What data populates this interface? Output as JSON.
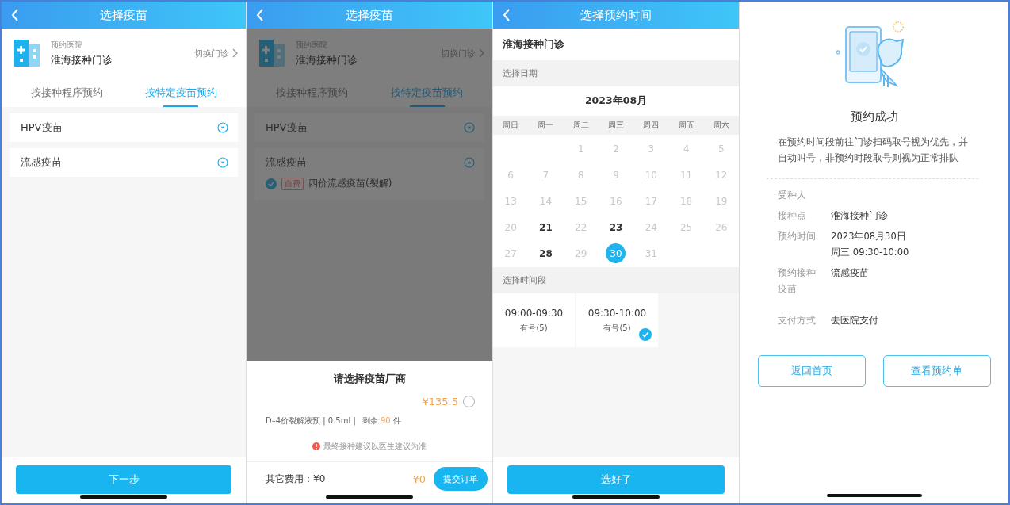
{
  "screen_1": {
    "title": "选择疫苗",
    "hospital": {
      "label": "预约医院",
      "name": "淮海接种门诊",
      "switch": "切换门诊"
    },
    "tabs": [
      {
        "label": "按接种程序预约",
        "selected": false
      },
      {
        "label": "按特定疫苗预约",
        "selected": true
      }
    ],
    "groups": [
      {
        "name": "HPV疫苗",
        "expanded": false
      },
      {
        "name": "流感疫苗",
        "expanded": false
      }
    ],
    "next_button": "下一步"
  },
  "screen_2": {
    "title": "选择疫苗",
    "hospital": {
      "label": "预约医院",
      "name": "淮海接种门诊",
      "switch": "切换门诊"
    },
    "tabs": [
      {
        "label": "按接种程序预约",
        "selected": false
      },
      {
        "label": "按特定疫苗预约",
        "selected": true
      }
    ],
    "groups": [
      {
        "name": "HPV疫苗",
        "expanded": false
      },
      {
        "name": "流感疫苗",
        "expanded": true,
        "items": [
          {
            "tag": "自费",
            "name": "四价流感疫苗(裂解)",
            "checked": true
          }
        ]
      }
    ],
    "sheet": {
      "title": "请选择疫苗厂商",
      "options": [
        {
          "price": "¥135.5",
          "selected": false,
          "spec": "D–4价裂解液预 | 0.5ml |",
          "stock_label": "剩余",
          "stock": "90",
          "unit": "件"
        }
      ],
      "note": "最终接种建议以医生建议为准",
      "other_fees": "其它费用：¥0",
      "total": "¥0",
      "submit": "提交订单"
    }
  },
  "screen_3": {
    "title": "选择预约时间",
    "clinic": "淮海接种门诊",
    "date_label": "选择日期",
    "month": "2023年08月",
    "weekdays": [
      "周日",
      "周一",
      "周二",
      "周三",
      "周四",
      "周五",
      "周六"
    ],
    "days": [
      {
        "day": "1",
        "available": false,
        "selected": false
      },
      {
        "day": "2",
        "available": false,
        "selected": false
      },
      {
        "day": "3",
        "available": false,
        "selected": false
      },
      {
        "day": "4",
        "available": false,
        "selected": false
      },
      {
        "day": "5",
        "available": false,
        "selected": false
      },
      {
        "day": "6",
        "available": false,
        "selected": false
      },
      {
        "day": "7",
        "available": false,
        "selected": false
      },
      {
        "day": "8",
        "available": false,
        "selected": false
      },
      {
        "day": "9",
        "available": false,
        "selected": false
      },
      {
        "day": "10",
        "available": false,
        "selected": false
      },
      {
        "day": "11",
        "available": false,
        "selected": false
      },
      {
        "day": "12",
        "available": false,
        "selected": false
      },
      {
        "day": "13",
        "available": false,
        "selected": false
      },
      {
        "day": "14",
        "available": false,
        "selected": false
      },
      {
        "day": "15",
        "available": false,
        "selected": false
      },
      {
        "day": "16",
        "available": false,
        "selected": false
      },
      {
        "day": "17",
        "available": false,
        "selected": false
      },
      {
        "day": "18",
        "available": false,
        "selected": false
      },
      {
        "day": "19",
        "available": false,
        "selected": false
      },
      {
        "day": "20",
        "available": false,
        "selected": false
      },
      {
        "day": "21",
        "available": true,
        "selected": false
      },
      {
        "day": "22",
        "available": false,
        "selected": false
      },
      {
        "day": "23",
        "available": true,
        "selected": false
      },
      {
        "day": "24",
        "available": false,
        "selected": false
      },
      {
        "day": "25",
        "available": false,
        "selected": false
      },
      {
        "day": "26",
        "available": false,
        "selected": false
      },
      {
        "day": "27",
        "available": false,
        "selected": false
      },
      {
        "day": "28",
        "available": true,
        "selected": false
      },
      {
        "day": "29",
        "available": false,
        "selected": false
      },
      {
        "day": "30",
        "available": true,
        "selected": true
      },
      {
        "day": "31",
        "available": false,
        "selected": false
      }
    ],
    "slot_label": "选择时间段",
    "slots": [
      {
        "time": "09:00-09:30",
        "status": "有号(5)",
        "selected": false
      },
      {
        "time": "09:30-10:00",
        "status": "有号(5)",
        "selected": true
      }
    ],
    "confirm": "选好了"
  },
  "screen_4": {
    "title": "预约成功",
    "message": "在预约时间段前往门诊扫码取号视为优先，并自动叫号，非预约时段取号则视为正常排队",
    "details": [
      {
        "label": "受种人"
      },
      {
        "label": "接种点",
        "value": "淮海接种门诊"
      },
      {
        "label": "预约时间",
        "value": "2023年08月30日",
        "value_2": "周三 09:30-10:00"
      },
      {
        "label": "预约接种疫苗",
        "value": "流感疫苗"
      },
      {
        "label": "支付方式",
        "value": "去医院支付"
      }
    ],
    "buttons": [
      "返回首页",
      "查看预约单"
    ]
  }
}
